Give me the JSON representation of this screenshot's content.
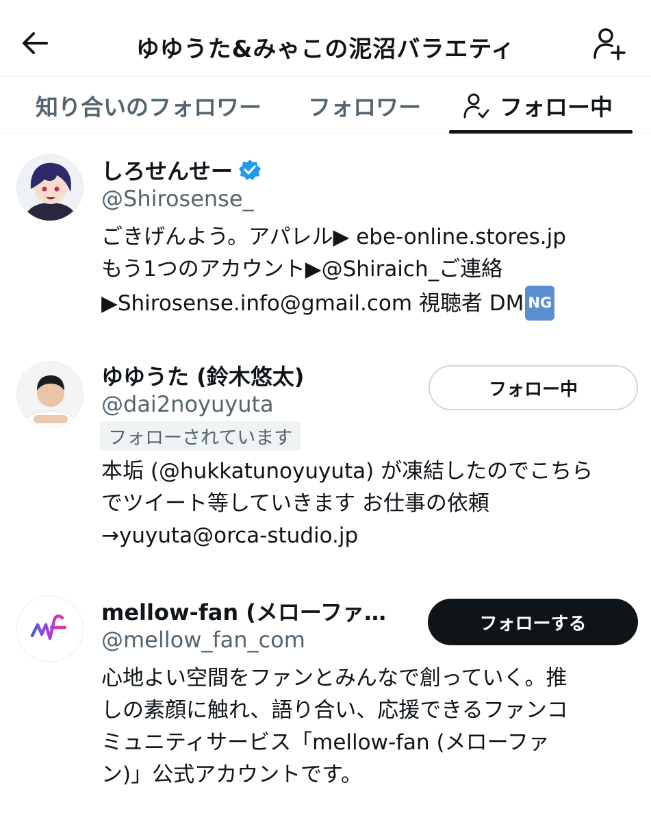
{
  "header": {
    "title": "ゆゆうた&みゃこの泥沼バラエティ",
    "back_icon": "arrow-left-icon",
    "add_icon": "person-add-icon"
  },
  "tabs": [
    {
      "label": "知り合いのフォロワー",
      "active": false
    },
    {
      "label": "フォロワー",
      "active": false
    },
    {
      "label": "フォロー中",
      "active": true,
      "icon": "person-check-icon"
    }
  ],
  "users": [
    {
      "name": "しろせんせー",
      "verified": true,
      "handle": "@Shirosense_",
      "bio_lines": [
        "ごきげんよう。アパレル▶ ebe-online.stores.jp",
        "もう1つのアカウント▶@Shiraich_ご連絡",
        "▶Shirosense.info@gmail.com 視聴者 DM"
      ],
      "bio_badge": "NG"
    },
    {
      "name": "ゆゆうた (鈴木悠太)",
      "handle": "@dai2noyuyuta",
      "follows_you": "フォローされています",
      "button": "フォロー中",
      "bio_lines": [
        "本垢 (@hukkatunoyuyuta) が凍結したのでこちら",
        "でツイート等していきます お仕事の依頼",
        "→yuyuta@orca-studio.jp"
      ]
    },
    {
      "name": "mellow-fan (メローファ…",
      "handle": "@mellow_fan_com",
      "button": "フォローする",
      "bio_lines": [
        "心地よい空間をファンとみんなで創っていく。推",
        "しの素顔に触れ、語り合い、応援できるファンコ",
        "ミュニティサービス「mellow-fan (メローファ",
        "ン)」公式アカウントです。"
      ]
    }
  ],
  "colors": {
    "text": "#0f1419",
    "secondary": "#536471",
    "verified": "#1d9bf0",
    "follow_button": "#0f1419"
  }
}
